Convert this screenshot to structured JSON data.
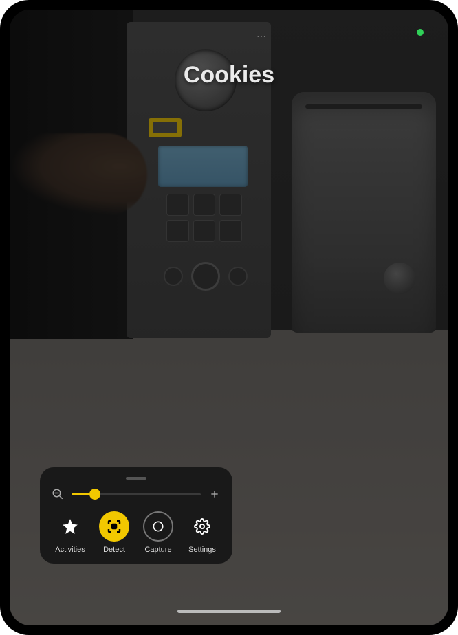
{
  "detection": {
    "title": "Cookies",
    "highlight_color": "#f2c800"
  },
  "status": {
    "camera_indicator": "active",
    "more_menu": "⋯"
  },
  "panel": {
    "zoom": {
      "minus_icon": "zoom-out-icon",
      "plus_icon": "zoom-in-icon",
      "value_percent": 18
    },
    "modes": [
      {
        "id": "activities",
        "label": "Activities",
        "icon": "star-icon",
        "active": false
      },
      {
        "id": "detect",
        "label": "Detect",
        "icon": "detect-icon",
        "active": true
      },
      {
        "id": "capture",
        "label": "Capture",
        "icon": "capture-icon",
        "active": false
      },
      {
        "id": "settings",
        "label": "Settings",
        "icon": "gear-icon",
        "active": false
      }
    ]
  }
}
